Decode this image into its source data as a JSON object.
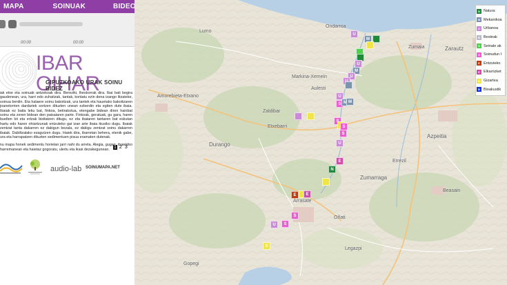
{
  "nav": {
    "items": [
      "MAPA",
      "SOINUAK",
      "BIDEOA"
    ]
  },
  "player": {
    "time_current": "00:00",
    "time_total": "00:00"
  },
  "hero": {
    "title": "IBAR OIHAR",
    "subtitle": "GIPUZKOAKO URAK SOINU BIDEZ"
  },
  "body": {
    "paragraphs": [
      "Ibaiak etxe eta soinuak antzekoak dira. Bereziki, lheskorrak dira. Ibai bati begira gaudenean, ura, harri edo zuhaitzak, tantak, kontatu ezin dena izango litzateke, soinua berdin. Eta halaere soinu bakoitzak, ura tantek eta hauetako bakoitzaren joanetorrien dardariek sortzen dituzten unean ezberdin eta egiten dute ibaia. Ibaiak ez baita leku bat, finkoa, betirakotua, etengabe bidean diren hainbat soinu eta zeren bidean den paisaiaren parte. Finkoak, geratuak, gu gara, haren buelten lot eta ertzak bisitatzen ditugu, ez eta ibaiaren tantaren bat eskutan hartu edo haren ohiartzunak entzuteko gai izan arte ibaia ikusiko dugu. Ibaiak zentzat tanta dakarren ez dakigun bezala, ez dakigu zentzat soinu dakarren ibaiak. Dabiltzalako ezagutzen dugu. Haiek dira, ibarretan behera, etenik gabe, ura eta harrapatzen dituzten sedimentuen pisua eramaten dutenak.",
      "Soinu mapa honek sedimentu horietan jarri nahi du arreta. Alegia, gugan, ibaiekiko harremanean eta haietaz gogoratu, ulertu eta ikasi dezakegunean."
    ]
  },
  "pager": {
    "pages": [
      "1",
      "2",
      "3"
    ],
    "active": "1"
  },
  "logos": {
    "audiolab": "audio-lab",
    "soinumapa": "SOINUMAPA.NET"
  },
  "map": {
    "places": [
      {
        "name": "Lumo"
      },
      {
        "name": "Ondarroa"
      },
      {
        "name": "Zumaia"
      },
      {
        "name": "Zarautz"
      },
      {
        "name": "Markina-Xemein"
      },
      {
        "name": "Amorebieta-Etxano"
      },
      {
        "name": "Durango"
      },
      {
        "name": "Azpeitia"
      },
      {
        "name": "Zumarraga"
      },
      {
        "name": "Beasain"
      },
      {
        "name": "Oñati"
      },
      {
        "name": "Gopegi"
      },
      {
        "name": "Etxebarri"
      },
      {
        "name": "Zaldibar"
      },
      {
        "name": "Aulesti"
      },
      {
        "name": "Errezil"
      },
      {
        "name": "Legazpi"
      },
      {
        "name": "Arrasate"
      }
    ],
    "markers": [
      "U",
      "M",
      "U",
      "M",
      "U",
      "U",
      "U",
      "S",
      "M",
      "M",
      "S",
      "M",
      "U",
      "S",
      "N",
      "S",
      "S",
      "S",
      "S",
      "E",
      "E",
      "N",
      "E",
      "S",
      "U",
      "E",
      "S",
      "U",
      "S",
      "U"
    ]
  },
  "legend": {
    "items": [
      {
        "letter": "N",
        "label": "Natura",
        "color": "#1f8a3a"
      },
      {
        "letter": "M",
        "label": "Mekanikoa",
        "color": "#7b93ae"
      },
      {
        "letter": "U",
        "label": "Urbanoa",
        "color": "#c98ad8"
      },
      {
        "letter": "B",
        "label": "Besteak",
        "color": "#b9b9c9"
      },
      {
        "letter": "S",
        "label": "Seinale ak",
        "color": "#4fd04a"
      },
      {
        "letter": "S",
        "label": "Soinudun I",
        "color": "#ee5cd1"
      },
      {
        "letter": "E",
        "label": "Entzuteko",
        "color": "#bf3c0d"
      },
      {
        "letter": "E",
        "label": "Elkarrizket",
        "color": "#cf4ca8"
      },
      {
        "letter": "G",
        "label": "Gizartea",
        "color": "#f0e44b"
      },
      {
        "letter": "B",
        "label": "Bioakustik",
        "color": "#1332d6"
      }
    ]
  },
  "colors": {
    "nav": "#8e3ea5",
    "title": "#9a5fae",
    "map_bg": "#e9e5dc"
  }
}
